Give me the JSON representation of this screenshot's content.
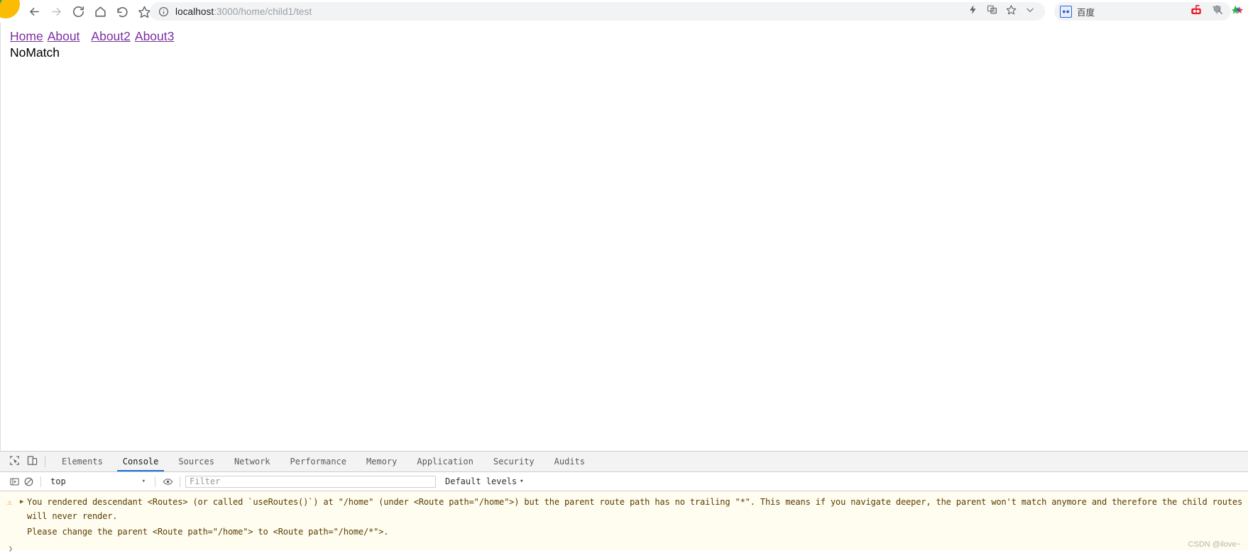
{
  "browser": {
    "nav": [
      {
        "name": "back-icon",
        "label": "Back",
        "disabled": false
      },
      {
        "name": "forward-icon",
        "label": "Forward",
        "disabled": true
      },
      {
        "name": "reload-icon",
        "label": "Reload",
        "disabled": false
      },
      {
        "name": "home-icon",
        "label": "Home",
        "disabled": false
      },
      {
        "name": "undo-icon",
        "label": "Undo close tab",
        "disabled": false
      },
      {
        "name": "star-outline-icon",
        "label": "Bookmark",
        "disabled": false
      }
    ],
    "omnibox": {
      "info_icon": "info-circle-icon",
      "host": "localhost",
      "path": ":3000/home/child1/test",
      "full_url": "localhost:3000/home/child1/test",
      "right_icons": [
        "lightning-icon",
        "translate-icon",
        "star-icon",
        "chevron-down-icon"
      ]
    },
    "search_box": {
      "engine_icon": "baidu-icon",
      "engine_label": "百度",
      "placeholder": "",
      "value": "",
      "magnifier_icon": "search-icon"
    },
    "extensions": [
      "extension-red-icon",
      "extension-grey-v-icon",
      "extension-colorful-icon"
    ]
  },
  "page": {
    "links": [
      {
        "label": "Home"
      },
      {
        "label": "About"
      },
      {
        "label": "About2"
      },
      {
        "label": "About3"
      }
    ],
    "body_text": "NoMatch",
    "link_color": "#7b2fa0"
  },
  "devtools": {
    "tool_icons": [
      "inspect-element-icon",
      "device-toolbar-icon"
    ],
    "tabs": [
      {
        "label": "Elements",
        "active": false
      },
      {
        "label": "Console",
        "active": true
      },
      {
        "label": "Sources",
        "active": false
      },
      {
        "label": "Network",
        "active": false
      },
      {
        "label": "Performance",
        "active": false
      },
      {
        "label": "Memory",
        "active": false
      },
      {
        "label": "Application",
        "active": false
      },
      {
        "label": "Security",
        "active": false
      },
      {
        "label": "Audits",
        "active": false
      }
    ],
    "filter_bar": {
      "sidebar_toggle_icon": "console-sidebar-icon",
      "clear_icon": "clear-console-icon",
      "context_value": "top",
      "context_caret": "▾",
      "eye_icon": "live-expression-icon",
      "filter_placeholder": "Filter",
      "filter_value": "",
      "levels_label": "Default levels",
      "levels_caret": "▾"
    },
    "console": {
      "entries": [
        {
          "severity": "warning",
          "icon": "warning-triangle-icon",
          "disclosure": "▶",
          "text": "You rendered descendant <Routes> (or called `useRoutes()`) at \"/home\" (under <Route path=\"/home\">) but the parent route path has no trailing \"*\". This means if you navigate deeper, the parent won't match anymore and therefore the child routes will never render.",
          "text2": "Please change the parent <Route path=\"/home\"> to <Route path=\"/home/*\">."
        }
      ],
      "prompt_caret": "❯",
      "background": "#fffdf0",
      "text_color": "#5c3c00"
    }
  },
  "watermark": "CSDN @ilove~"
}
